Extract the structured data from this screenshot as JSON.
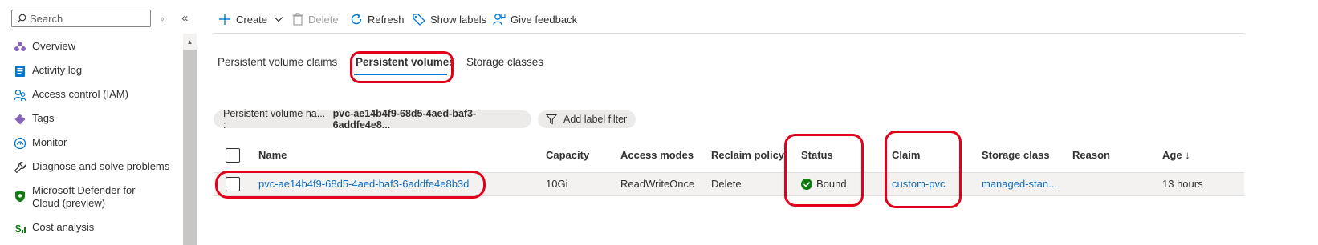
{
  "sidebar": {
    "search_placeholder": "Search",
    "items": [
      {
        "label": "Overview",
        "icon": "overview-icon"
      },
      {
        "label": "Activity log",
        "icon": "activity-log-icon"
      },
      {
        "label": "Access control (IAM)",
        "icon": "people-icon"
      },
      {
        "label": "Tags",
        "icon": "tag-icon"
      },
      {
        "label": "Monitor",
        "icon": "monitor-icon"
      },
      {
        "label": "Diagnose and solve problems",
        "icon": "wrench-icon"
      },
      {
        "label": "Microsoft Defender for Cloud (preview)",
        "icon": "shield-icon"
      },
      {
        "label": "Cost analysis",
        "icon": "cost-icon"
      }
    ]
  },
  "toolbar": {
    "create": "Create",
    "delete": "Delete",
    "refresh": "Refresh",
    "show_labels": "Show labels",
    "give_feedback": "Give feedback"
  },
  "tabs": [
    {
      "label": "Persistent volume claims",
      "active": false
    },
    {
      "label": "Persistent volumes",
      "active": true
    },
    {
      "label": "Storage classes",
      "active": false
    }
  ],
  "filters": {
    "pv_name_key": "Persistent volume na... :",
    "pv_name_value": "pvc-ae14b4f9-68d5-4aed-baf3-6addfe4e8...",
    "add_label_filter": "Add label filter"
  },
  "table": {
    "columns": [
      "Name",
      "Capacity",
      "Access modes",
      "Reclaim policy",
      "Status",
      "Claim",
      "Storage class",
      "Reason",
      "Age ↓"
    ],
    "rows": [
      {
        "name": "pvc-ae14b4f9-68d5-4aed-baf3-6addfe4e8b3d",
        "capacity": "10Gi",
        "access_modes": "ReadWriteOnce",
        "reclaim_policy": "Delete",
        "status": "Bound",
        "claim": "custom-pvc",
        "storage_class": "managed-stan...",
        "reason": "",
        "age": "13 hours"
      }
    ]
  },
  "colors": {
    "accent": "#0078d4",
    "link": "#0f6cbd",
    "success": "#107c10",
    "annotation": "#e3001b"
  }
}
